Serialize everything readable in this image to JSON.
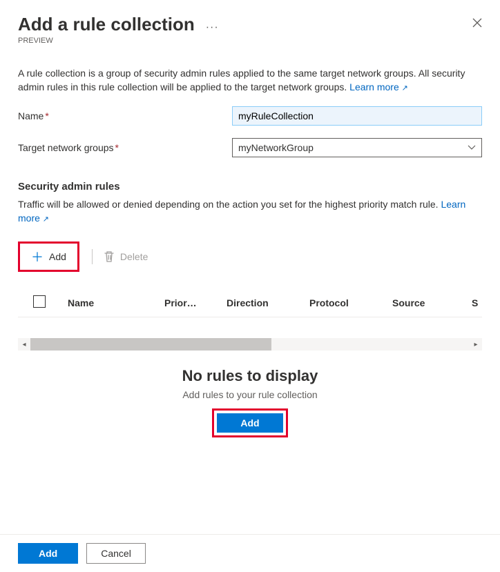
{
  "header": {
    "title": "Add a rule collection",
    "more_glyph": "···",
    "preview_badge": "PREVIEW"
  },
  "description": {
    "text": "A rule collection is a group of security admin rules applied to the same target network groups. All security admin rules in this rule collection will be applied to the target network groups. ",
    "learn_more": "Learn more"
  },
  "fields": {
    "name_label": "Name",
    "name_value": "myRuleCollection",
    "target_label": "Target network groups",
    "target_value": "myNetworkGroup"
  },
  "section": {
    "title": "Security admin rules",
    "desc_text": "Traffic will be allowed or denied depending on the action you set for the highest priority match rule. ",
    "learn_more": "Learn more"
  },
  "toolbar": {
    "add_label": "Add",
    "delete_label": "Delete"
  },
  "grid": {
    "columns": {
      "name": "Name",
      "priority": "Prior…",
      "direction": "Direction",
      "protocol": "Protocol",
      "source": "Source",
      "source_port": "S"
    }
  },
  "empty_state": {
    "title": "No rules to display",
    "subtitle": "Add rules to your rule collection",
    "add_button": "Add"
  },
  "footer": {
    "add": "Add",
    "cancel": "Cancel"
  }
}
